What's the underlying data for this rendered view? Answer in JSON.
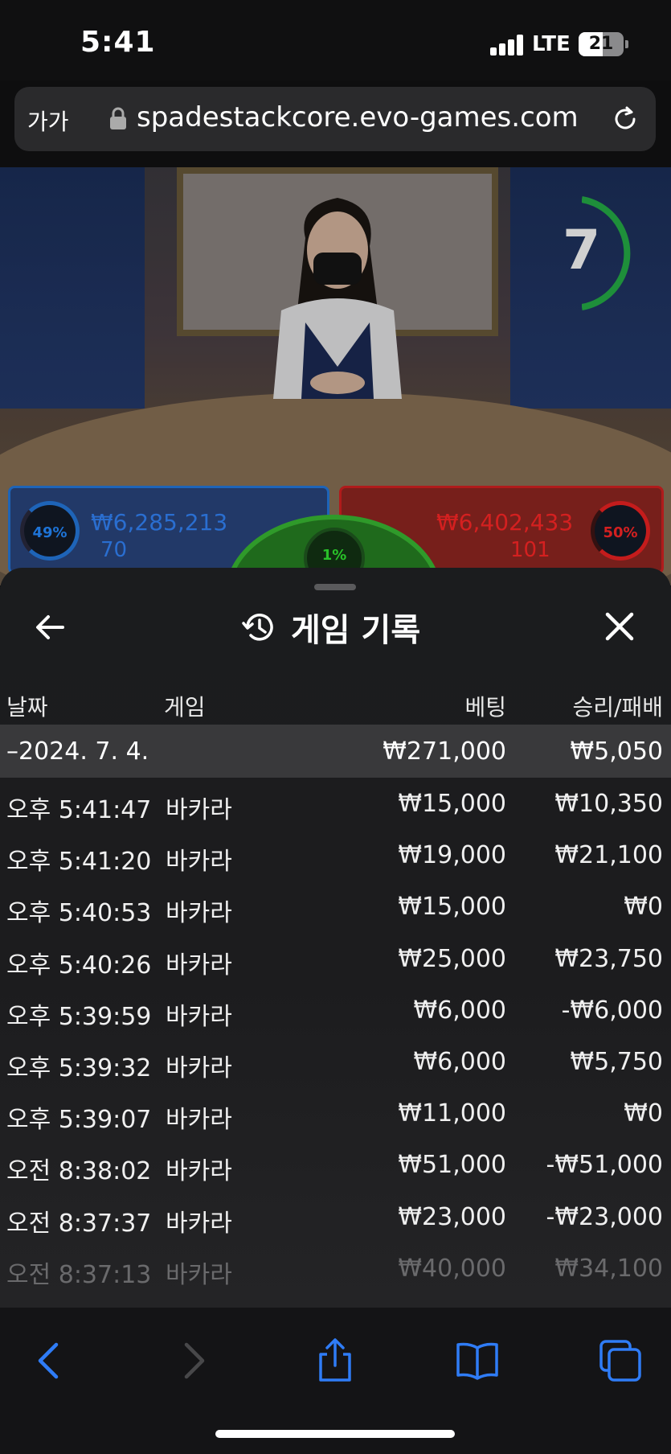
{
  "status_bar": {
    "time": "5:41",
    "network": "LTE",
    "battery": "21"
  },
  "browser": {
    "text_size_label": "가가",
    "url": "spadestackcore.evo-games.com"
  },
  "live_game": {
    "timer": "7",
    "player": {
      "percent": "49%",
      "amount": "₩6,285,213",
      "count": "70"
    },
    "banker": {
      "percent": "50%",
      "amount": "₩6,402,433",
      "count": "101"
    },
    "tie": {
      "percent": "1%"
    }
  },
  "sheet": {
    "title": "게임 기록",
    "columns": {
      "date": "날짜",
      "game": "게임",
      "bet": "베팅",
      "win_loss": "승리/패배"
    },
    "date_group": {
      "date": "–2024. 7. 4.",
      "bet_total": "₩271,000",
      "win_total": "₩5,050"
    },
    "rows": [
      {
        "time": "오후 5:41:47",
        "game": "바카라",
        "bet": "₩15,000",
        "win": "₩10,350"
      },
      {
        "time": "오후 5:41:20",
        "game": "바카라",
        "bet": "₩19,000",
        "win": "₩21,100"
      },
      {
        "time": "오후 5:40:53",
        "game": "바카라",
        "bet": "₩15,000",
        "win": "₩0"
      },
      {
        "time": "오후 5:40:26",
        "game": "바카라",
        "bet": "₩25,000",
        "win": "₩23,750"
      },
      {
        "time": "오후 5:39:59",
        "game": "바카라",
        "bet": "₩6,000",
        "win": "-₩6,000"
      },
      {
        "time": "오후 5:39:32",
        "game": "바카라",
        "bet": "₩6,000",
        "win": "₩5,750"
      },
      {
        "time": "오후 5:39:07",
        "game": "바카라",
        "bet": "₩11,000",
        "win": "₩0"
      },
      {
        "time": "오전 8:38:02",
        "game": "바카라",
        "bet": "₩51,000",
        "win": "-₩51,000"
      },
      {
        "time": "오전 8:37:37",
        "game": "바카라",
        "bet": "₩23,000",
        "win": "-₩23,000"
      },
      {
        "time": "오전 8:37:13",
        "game": "바카라",
        "bet": "₩40,000",
        "win": "₩34,100"
      }
    ]
  },
  "icons": {
    "back": "arrow-left-icon",
    "history": "history-icon",
    "close": "close-icon",
    "nav_back": "chevron-left-icon",
    "nav_forward": "chevron-right-icon",
    "share": "share-icon",
    "bookmarks": "book-icon",
    "tabs": "tabs-icon"
  },
  "colors": {
    "accent": "#2f7cf6",
    "player": "#1e64b8",
    "banker": "#b01b1b",
    "tie": "#2f9a2a"
  }
}
